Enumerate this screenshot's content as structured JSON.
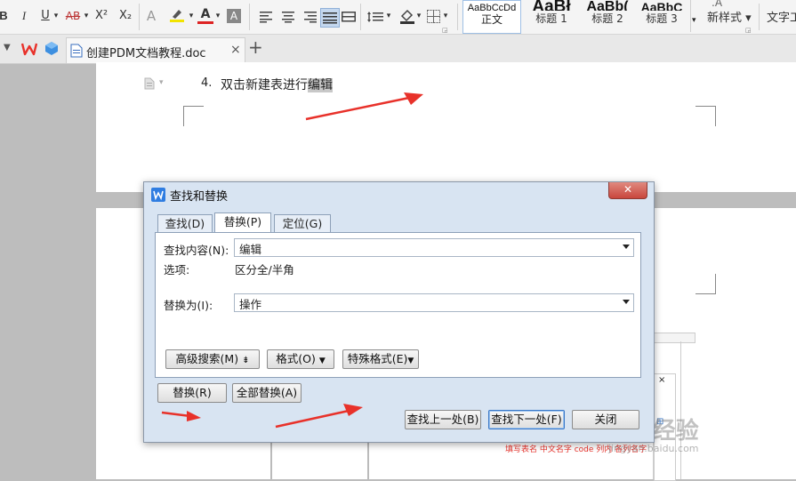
{
  "ribbon": {
    "format_buttons": [
      "B",
      "I",
      "U",
      "AB",
      "X²",
      "X₂",
      "A",
      "A",
      "A"
    ],
    "styles": [
      {
        "preview": "AaBbCcDd",
        "label": "正文"
      },
      {
        "preview": "AaBł",
        "label": "标题 1"
      },
      {
        "preview": "AaBb(",
        "label": "标题 2"
      },
      {
        "preview": "AaBbC",
        "label": "标题 3"
      }
    ],
    "new_style_label": "新样式",
    "text_tool_label": "文字工"
  },
  "tabbar": {
    "document_tab": "创建PDM文档教程.doc",
    "close_glyph": "×",
    "add_glyph": "+"
  },
  "document": {
    "list_number": "4.",
    "line_text": "双击新建表进行",
    "highlighted_word": "编辑"
  },
  "dialog": {
    "title": "查找和替换",
    "close_glyph": "✕",
    "tabs": [
      "查找(D)",
      "替换(P)",
      "定位(G)"
    ],
    "active_tab": "替换(P)",
    "find_label": "查找内容(N):",
    "find_value": "编辑",
    "options_label": "选项:",
    "options_value": "区分全/半角",
    "replace_label": "替换为(I):",
    "replace_value": "操作",
    "advanced_search_button": "高级搜索(M)",
    "format_button": "格式(O)",
    "special_format_button": "特殊格式(E)",
    "replace_button": "替换(R)",
    "replace_all_button": "全部替换(A)",
    "find_prev_button": "查找上一处(B)",
    "find_next_button": "查找下一处(F)",
    "close_button": "关闭"
  },
  "background_text": {
    "watermark": "Bai 经验",
    "watermark_url": "jingyan.baidu.com",
    "red_caption": "填写表名  中文名字    code  列内  各列名字"
  },
  "colors": {
    "accent_red": "#e8312a",
    "dialog_bg": "#d8e4f2",
    "close_red": "#c9463d"
  }
}
